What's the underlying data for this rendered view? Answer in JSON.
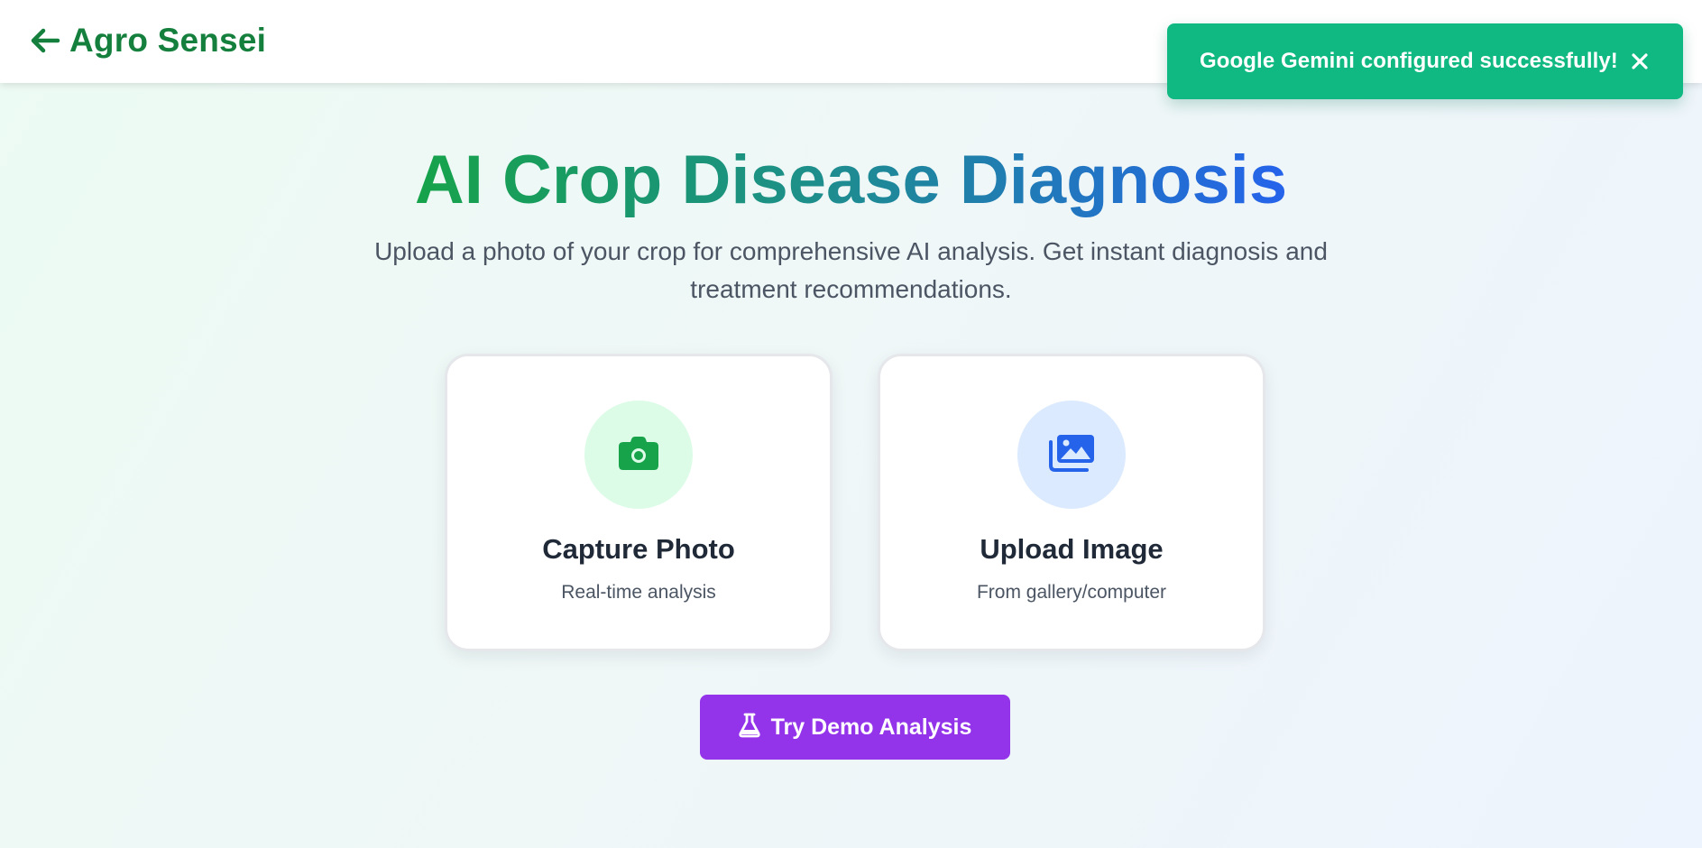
{
  "header": {
    "back_icon": "arrow-left-icon",
    "title": "Agro Sensei"
  },
  "toast": {
    "message": "Google Gemini configured successfully!",
    "close_icon": "close-icon",
    "color": "#10b981"
  },
  "hero": {
    "title": "AI Crop Disease Diagnosis",
    "subtitle": "Upload a photo of your crop for comprehensive AI analysis. Get instant diagnosis and treatment recommendations."
  },
  "options": {
    "capture": {
      "icon": "camera-icon",
      "title": "Capture Photo",
      "subtitle": "Real-time analysis",
      "accent": "#16a34a"
    },
    "upload": {
      "icon": "images-icon",
      "title": "Upload Image",
      "subtitle": "From gallery/computer",
      "accent": "#2563eb"
    }
  },
  "demo": {
    "icon": "flask-icon",
    "label": "Try Demo Analysis",
    "color": "#9333ea"
  },
  "colors": {
    "brand": "#15803d",
    "title_gradient_start": "#16a34a",
    "title_gradient_end": "#2563eb"
  }
}
